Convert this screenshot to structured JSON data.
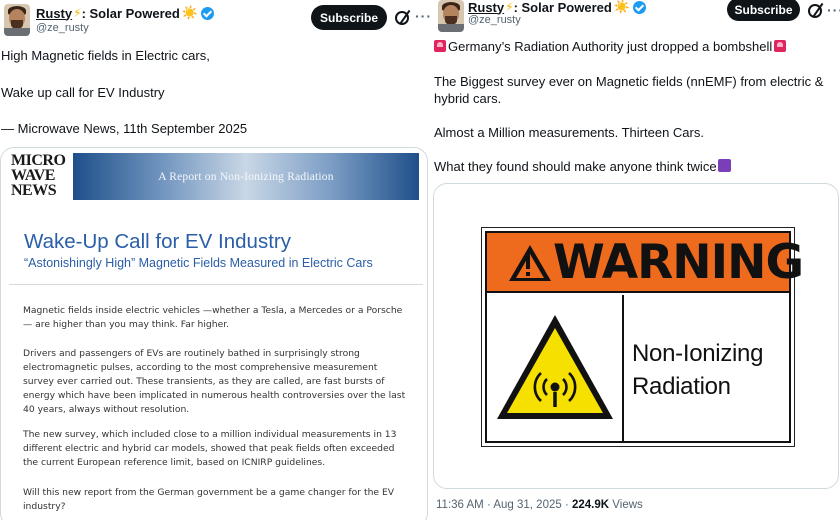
{
  "left_post": {
    "author": {
      "name": "Rusty",
      "name_suffix": ": Solar Powered",
      "bolt_icon": "⚡",
      "sun_icon": "☀️",
      "handle": "@ze_rusty"
    },
    "subscribe_label": "Subscribe",
    "more_label": "···",
    "text_lines": [
      "High Magnetic fields in Electric cars,",
      "Wake up call for EV Industry",
      "— Microwave News, 11th September 2025"
    ],
    "card": {
      "logo_lines": [
        "MICRO",
        "WAVE",
        "NEWS"
      ],
      "banner": "A Report on Non-Ionizing Radiation",
      "title": "Wake-Up Call for EV Industry",
      "subtitle": "“Astonishingly High” Magnetic Fields Measured in Electric Cars",
      "paragraphs": [
        "Magnetic fields inside electric vehicles —whether a Tesla, a Mercedes or a Porsche — are higher than you may think. Far higher.",
        "Drivers and passengers of EVs are routinely bathed in surprisingly strong electromagnetic pulses, according to the most comprehensive measurement survey ever carried out. These transients, as they are called, are fast bursts of energy which have been implicated in numerous health controversies over the last 40 years, always without resolution.",
        "The new survey, which included close to a million individual measurements in 13 different electric and hybrid car models, showed that peak fields often exceeded the current European reference limit, based on ICNIRP guidelines.",
        "Will this new report from the German government be a game changer for the EV industry?"
      ]
    }
  },
  "right_post": {
    "author": {
      "name": "Rusty",
      "name_suffix": ": Solar Powered",
      "bolt_icon": "⚡",
      "sun_icon": "☀️",
      "handle": "@ze_rusty"
    },
    "subscribe_label": "Subscribe",
    "more_label": "···",
    "text_lines": [
      "Germany’s Radiation Authority just dropped a bombshell",
      "The Biggest survey ever on Magnetic fields (nnEMF) from electric &",
      "hybrid cars.",
      "Almost a Million measurements. Thirteen Cars.",
      "What they found should make anyone think twice"
    ],
    "sign": {
      "header": "WARNING",
      "line1": "Non-Ionizing",
      "line2": "Radiation"
    },
    "meta": {
      "time": "11:36 AM",
      "date": "Aug 31, 2025",
      "views_count": "224.9K",
      "views_label": "Views"
    }
  },
  "colors": {
    "accent_blue": "#1d9bf0",
    "report_blue": "#2a5ea8",
    "warning_orange": "#ee6b1e",
    "radiation_yellow": "#f5e000"
  }
}
